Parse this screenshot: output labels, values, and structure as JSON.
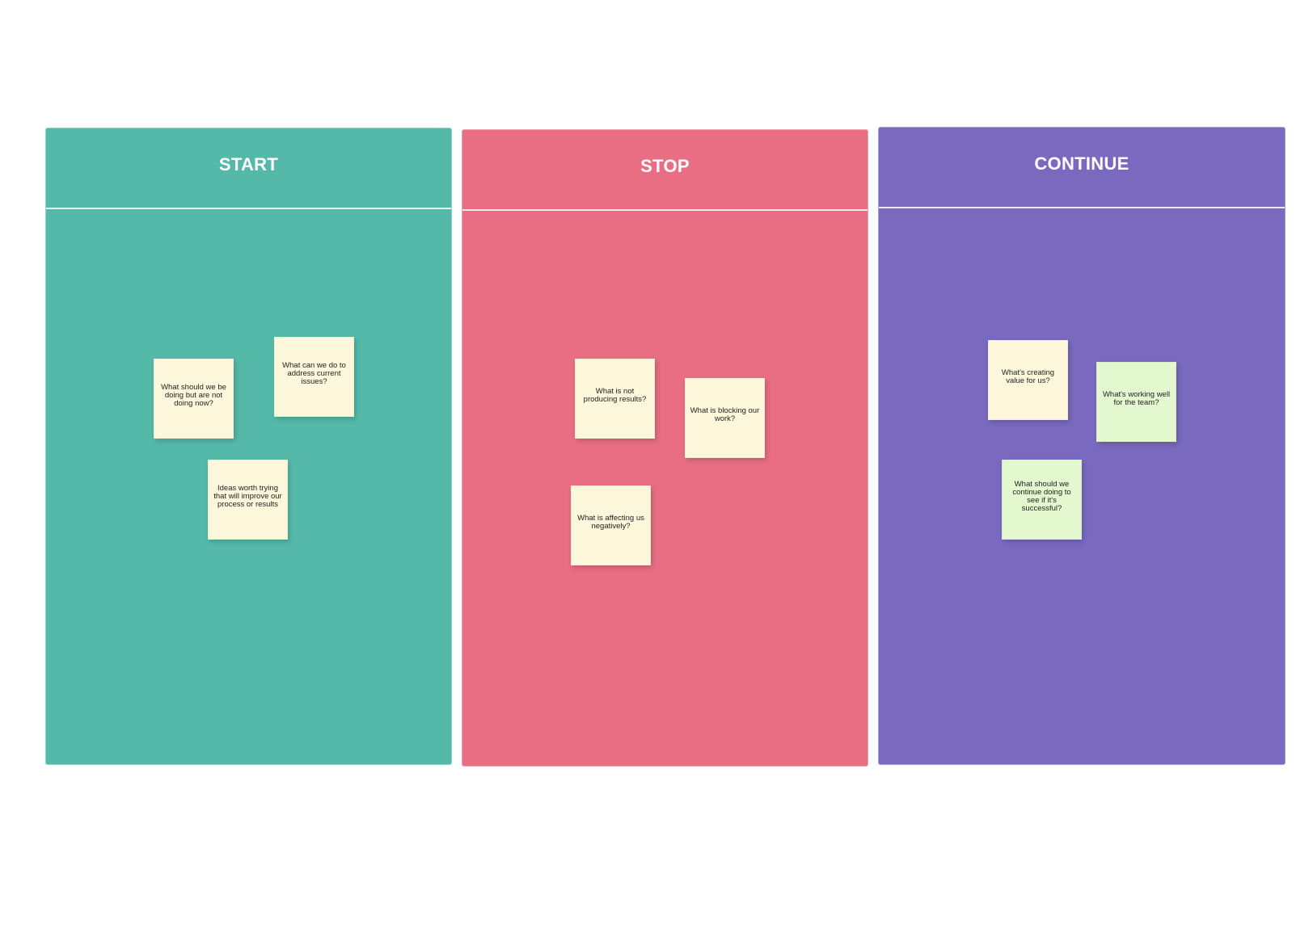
{
  "board": {
    "columns": [
      {
        "title": "START",
        "color": "#55b9a9",
        "notes": [
          {
            "text": "What should we be doing but are not doing now?",
            "color": "yellow"
          },
          {
            "text": "What can we do to address current issues?",
            "color": "yellow"
          },
          {
            "text": "Ideas worth trying that will improve our process or results",
            "color": "yellow"
          }
        ]
      },
      {
        "title": "STOP",
        "color": "#e96e83",
        "notes": [
          {
            "text": "What is not producing results?",
            "color": "yellow"
          },
          {
            "text": "What is blocking our work?",
            "color": "yellow"
          },
          {
            "text": "What is affecting us negatively?",
            "color": "yellow"
          }
        ]
      },
      {
        "title": "CONTINUE",
        "color": "#7a6abf",
        "notes": [
          {
            "text": "What's creating value for us?",
            "color": "yellow"
          },
          {
            "text": "What's working well for the team?",
            "color": "green"
          },
          {
            "text": "What should we continue doing to see if it's successful?",
            "color": "green"
          }
        ]
      }
    ],
    "note_colors": {
      "yellow": "#fdf7dc",
      "green": "#e3f8cf"
    }
  }
}
